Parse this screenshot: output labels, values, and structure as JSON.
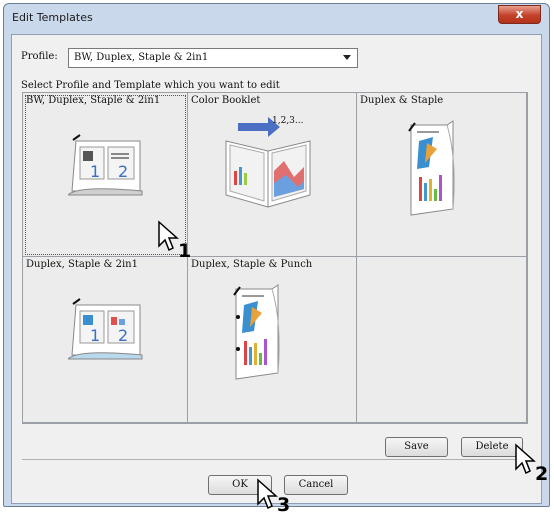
{
  "window": {
    "title": "Edit Templates",
    "close_label": "x"
  },
  "profile": {
    "label": "Profile:",
    "value": "BW, Duplex, Staple & 2in1"
  },
  "instruction": "Select Profile and Template which you want to edit",
  "templates": [
    {
      "name": "BW, Duplex, Staple & 2in1",
      "icon": "bw-2in1-icon"
    },
    {
      "name": "Color Booklet",
      "icon": "booklet-icon",
      "overlay": "1,2,3..."
    },
    {
      "name": "Duplex & Staple",
      "icon": "duplex-staple-icon"
    },
    {
      "name": "Duplex, Staple & 2in1",
      "icon": "duplex-2in1-icon"
    },
    {
      "name": "Duplex, Staple & Punch",
      "icon": "duplex-punch-icon"
    },
    {
      "name": "",
      "icon": ""
    }
  ],
  "buttons": {
    "save": "Save",
    "delete": "Delete",
    "ok": "OK",
    "cancel": "Cancel"
  },
  "callouts": [
    "1",
    "2",
    "3"
  ],
  "colors": {
    "title_bg": "#c9d8ea",
    "close_bg": "#c4422b",
    "client_bg": "#f0f0f0"
  }
}
